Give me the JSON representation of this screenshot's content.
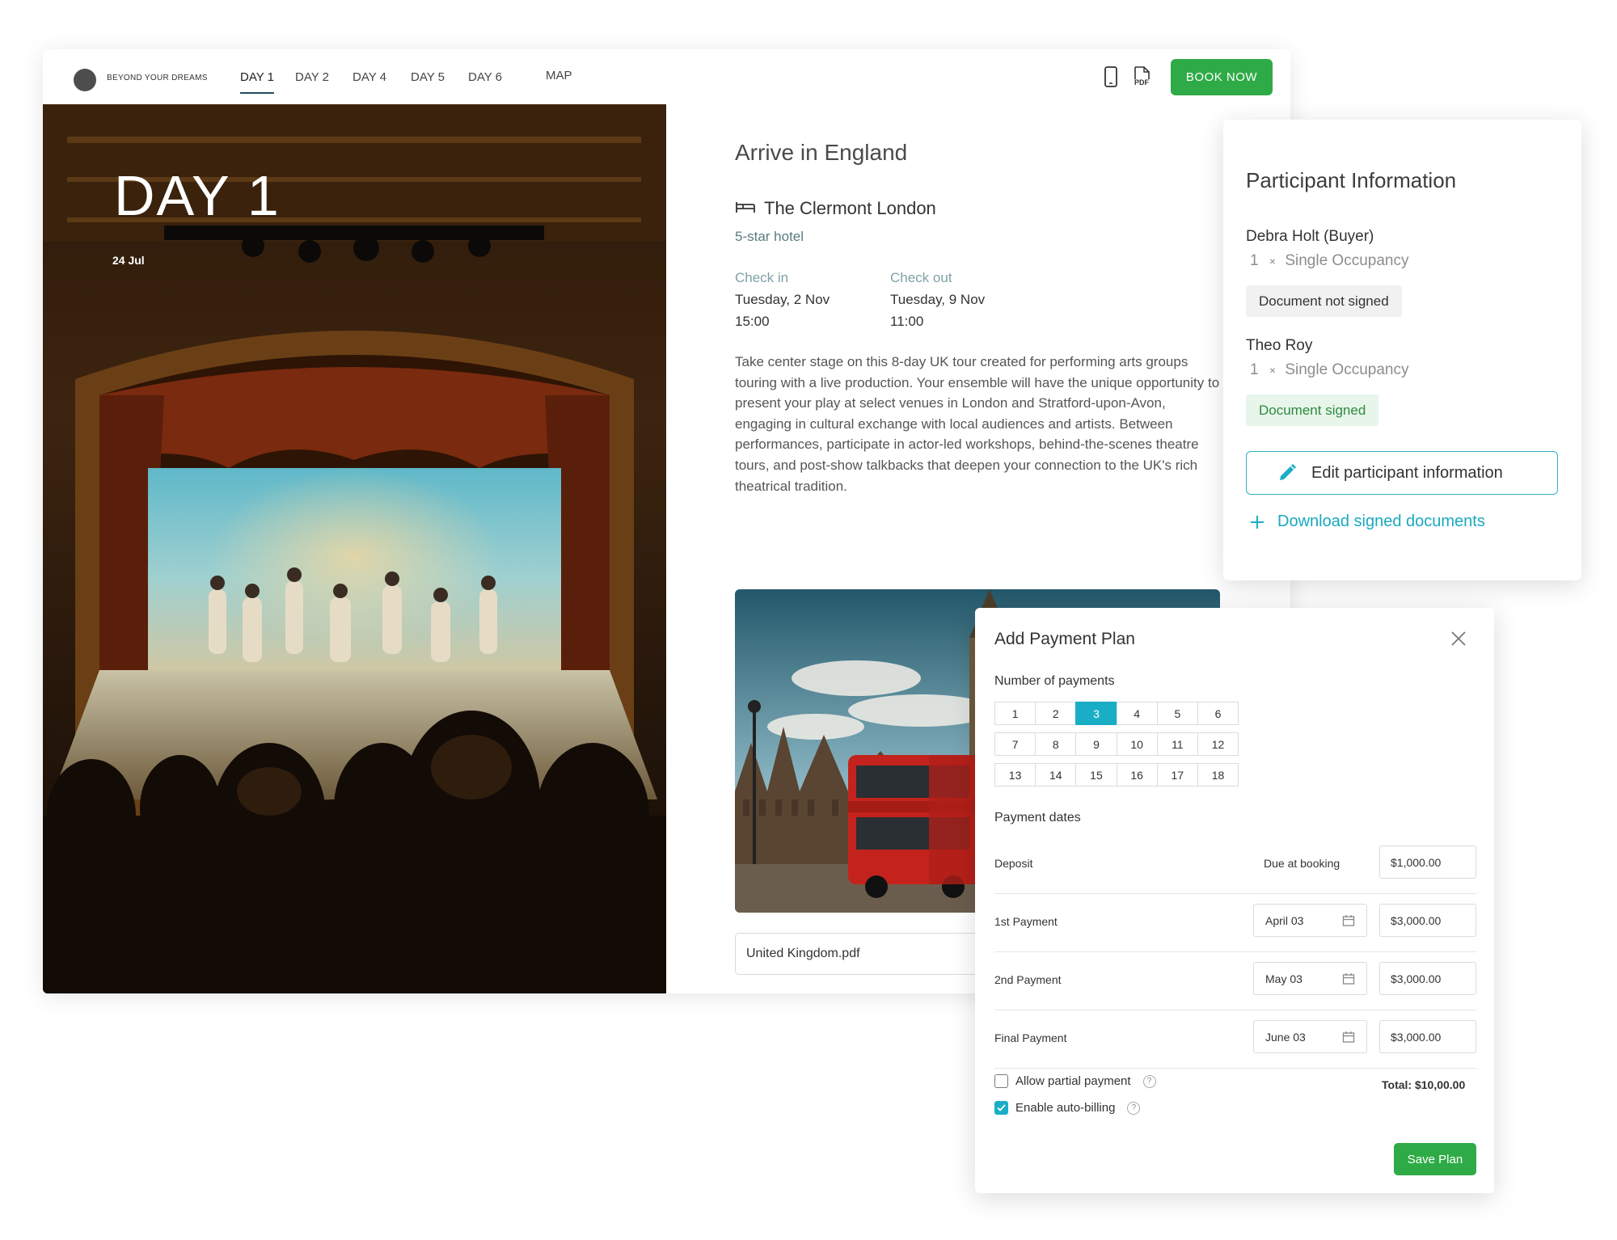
{
  "brand": {
    "name": "BEYOND YOUR DREAMS"
  },
  "nav": {
    "tabs": [
      "DAY 1",
      "DAY 2",
      "DAY 4",
      "DAY 5",
      "DAY 6"
    ],
    "map_label": "MAP",
    "pdf_label": "PDF",
    "book_label": "BOOK NOW"
  },
  "hero": {
    "title": "DAY 1",
    "date": "24 Jul"
  },
  "day": {
    "heading": "Arrive in England",
    "hotel_name": "The Clermont London",
    "hotel_type": "5-star hotel",
    "checkin_label": "Check in",
    "checkin_date": "Tuesday, 2 Nov",
    "checkin_time": "15:00",
    "checkout_label": "Check out",
    "checkout_date": "Tuesday, 9 Nov",
    "checkout_time": "11:00",
    "description": "Take center stage on this 8-day UK tour created for performing arts groups touring with a live production. Your ensemble will have the unique opportunity to present your play at select venues in London and Stratford-upon-Avon, engaging in cultural exchange with local audiences and artists. Between performances, participate in actor-led workshops, behind-the-scenes theatre tours, and post-show talkbacks that deepen your connection to the UK's rich theatrical tradition.",
    "attachment": "United Kingdom.pdf"
  },
  "participants": {
    "title": "Participant Information",
    "people": [
      {
        "name": "Debra Holt (Buyer)",
        "qty": "1",
        "times": "×",
        "room": "Single Occupancy",
        "status": "Document not signed"
      },
      {
        "name": "Theo Roy",
        "qty": "1",
        "times": "×",
        "room": "Single Occupancy",
        "status": "Document signed"
      }
    ],
    "edit_label": "Edit participant information",
    "download_label": "Download signed documents"
  },
  "payment_plan": {
    "title": "Add Payment Plan",
    "number_label": "Number of payments",
    "numbers": [
      [
        "1",
        "2",
        "3",
        "4",
        "5",
        "6"
      ],
      [
        "7",
        "8",
        "9",
        "10",
        "11",
        "12"
      ],
      [
        "13",
        "14",
        "15",
        "16",
        "17",
        "18"
      ]
    ],
    "selected": "3",
    "dates_label": "Payment dates",
    "deposit": {
      "name": "Deposit",
      "note": "Due at booking",
      "amount": "$1,000.00"
    },
    "payments": [
      {
        "name": "1st Payment",
        "date": "April 03",
        "amount": "$3,000.00"
      },
      {
        "name": "2nd Payment",
        "date": "May 03",
        "amount": "$3,000.00"
      },
      {
        "name": "Final Payment",
        "date": "June 03",
        "amount": "$3,000.00"
      }
    ],
    "partial_label": "Allow partial payment",
    "partial_checked": false,
    "autobill_label": "Enable auto-billing",
    "autobill_checked": true,
    "help_glyph": "?",
    "total": "Total: $10,00.00",
    "save_label": "Save Plan"
  },
  "colors": {
    "brand_green": "#2eab46",
    "accent_teal": "#1aaec6",
    "signed_bg": "#e8f5ea"
  }
}
